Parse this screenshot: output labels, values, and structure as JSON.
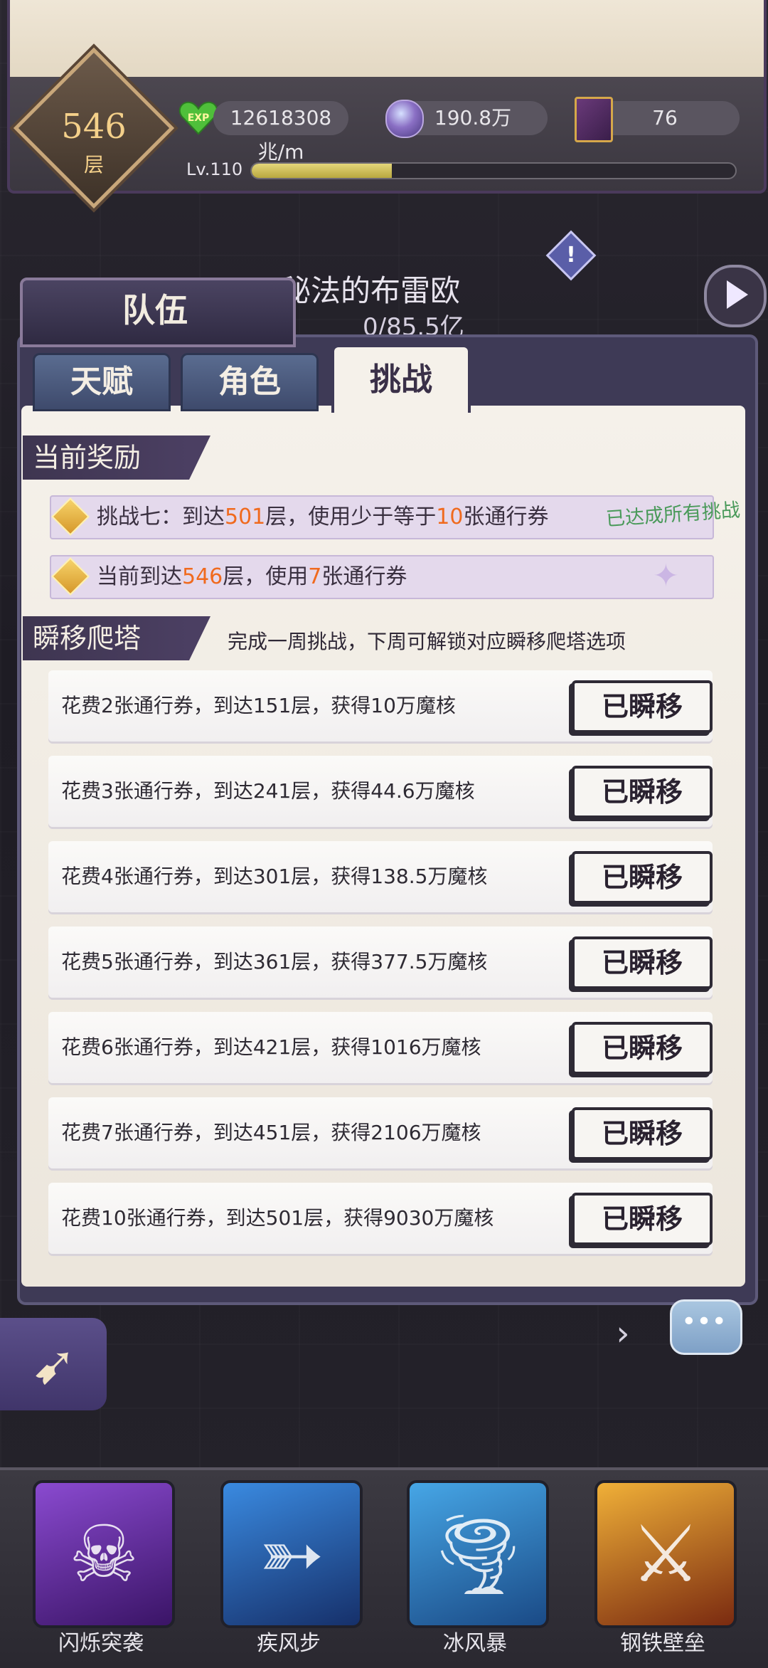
{
  "status": {
    "floor": "546",
    "floor_unit": "层",
    "exp_rate": "12618308兆/m",
    "exp_icon_text": "EXP",
    "magic_core": "190.8万",
    "tickets": "76",
    "level": "Lv.110",
    "level_progress": 0.29
  },
  "background": {
    "boss_name": "秘法的布雷欧",
    "boss_hp": "0/85.5亿"
  },
  "panel": {
    "title": "队伍",
    "tabs": [
      {
        "label": "天赋",
        "active": false
      },
      {
        "label": "角色",
        "active": false
      },
      {
        "label": "挑战",
        "active": true
      }
    ]
  },
  "current_reward": {
    "heading": "当前奖励",
    "challenge": {
      "prefix": "挑战七：到达",
      "floor": "501",
      "mid": "层，使用少于等于",
      "count": "10",
      "suffix": "张通行券",
      "note": "已达成所有挑战"
    },
    "current": {
      "prefix": "当前到达",
      "floor": "546",
      "mid": "层，使用",
      "count": "7",
      "suffix": "张通行券"
    }
  },
  "teleport": {
    "heading": "瞬移爬塔",
    "description": "完成一周挑战，下周可解锁对应瞬移爬塔选项",
    "options": [
      {
        "text": "花费2张通行券，到达151层，获得10万魔核",
        "button": "已瞬移"
      },
      {
        "text": "花费3张通行券，到达241层，获得44.6万魔核",
        "button": "已瞬移"
      },
      {
        "text": "花费4张通行券，到达301层，获得138.5万魔核",
        "button": "已瞬移"
      },
      {
        "text": "花费5张通行券，到达361层，获得377.5万魔核",
        "button": "已瞬移"
      },
      {
        "text": "花费6张通行券，到达421层，获得1016万魔核",
        "button": "已瞬移"
      },
      {
        "text": "花费7张通行券，到达451层，获得2106万魔核",
        "button": "已瞬移"
      },
      {
        "text": "花费10张通行券，到达501层，获得9030万魔核",
        "button": "已瞬移"
      }
    ]
  },
  "skills": [
    {
      "label": "闪烁突袭",
      "color": "#6a2fa8",
      "icon": "shadow-strike-icon"
    },
    {
      "label": "疾风步",
      "color": "#2d6fc0",
      "icon": "dash-icon"
    },
    {
      "label": "冰风暴",
      "color": "#2f82c8",
      "icon": "tornado-icon"
    },
    {
      "label": "钢铁壁垒",
      "color": "#c06a1c",
      "icon": "shield-blade-icon"
    }
  ]
}
